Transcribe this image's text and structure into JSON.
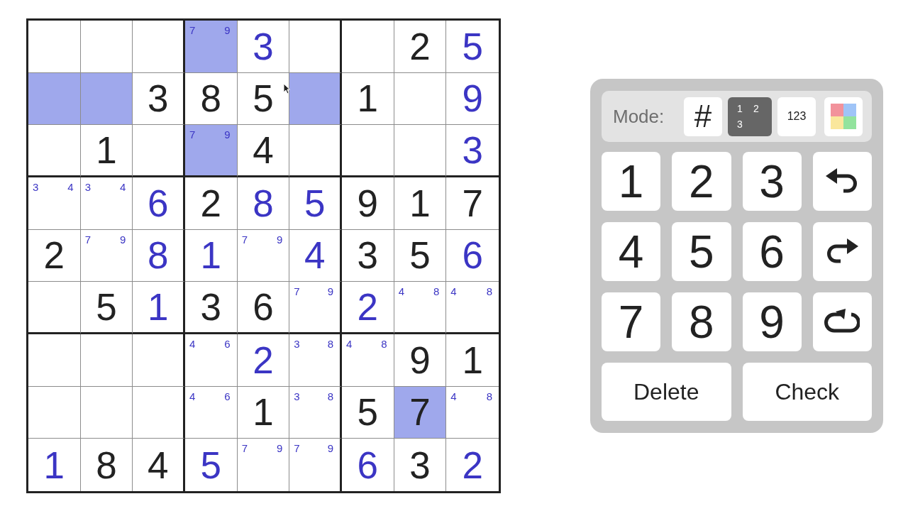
{
  "board": {
    "rows": [
      {
        "cells": [
          {
            "kind": "empty",
            "selected": false
          },
          {
            "kind": "empty",
            "selected": false
          },
          {
            "kind": "empty",
            "selected": false
          },
          {
            "kind": "notes",
            "notes": [
              "7",
              "9"
            ],
            "selected": true
          },
          {
            "kind": "entered",
            "value": "3",
            "selected": false
          },
          {
            "kind": "empty",
            "selected": false
          },
          {
            "kind": "empty",
            "selected": false
          },
          {
            "kind": "given",
            "value": "2",
            "selected": false
          },
          {
            "kind": "entered",
            "value": "5",
            "selected": false
          }
        ]
      },
      {
        "cells": [
          {
            "kind": "empty",
            "selected": true
          },
          {
            "kind": "empty",
            "selected": true
          },
          {
            "kind": "given",
            "value": "3",
            "selected": false
          },
          {
            "kind": "given",
            "value": "8",
            "selected": false
          },
          {
            "kind": "given",
            "value": "5",
            "selected": false
          },
          {
            "kind": "empty",
            "selected": true
          },
          {
            "kind": "given",
            "value": "1",
            "selected": false
          },
          {
            "kind": "empty",
            "selected": false
          },
          {
            "kind": "entered",
            "value": "9",
            "selected": false
          }
        ]
      },
      {
        "cells": [
          {
            "kind": "empty",
            "selected": false
          },
          {
            "kind": "given",
            "value": "1",
            "selected": false
          },
          {
            "kind": "empty",
            "selected": false
          },
          {
            "kind": "notes",
            "notes": [
              "7",
              "9"
            ],
            "selected": true
          },
          {
            "kind": "given",
            "value": "4",
            "selected": false
          },
          {
            "kind": "empty",
            "selected": false
          },
          {
            "kind": "empty",
            "selected": false
          },
          {
            "kind": "empty",
            "selected": false
          },
          {
            "kind": "entered",
            "value": "3",
            "selected": false
          }
        ]
      },
      {
        "cells": [
          {
            "kind": "notes",
            "notes": [
              "3",
              "4"
            ],
            "selected": false
          },
          {
            "kind": "notes",
            "notes": [
              "3",
              "4"
            ],
            "selected": false
          },
          {
            "kind": "entered",
            "value": "6",
            "selected": false
          },
          {
            "kind": "given",
            "value": "2",
            "selected": false
          },
          {
            "kind": "entered",
            "value": "8",
            "selected": false
          },
          {
            "kind": "entered",
            "value": "5",
            "selected": false
          },
          {
            "kind": "given",
            "value": "9",
            "selected": false
          },
          {
            "kind": "given",
            "value": "1",
            "selected": false
          },
          {
            "kind": "given",
            "value": "7",
            "selected": false
          }
        ]
      },
      {
        "cells": [
          {
            "kind": "given",
            "value": "2",
            "selected": false
          },
          {
            "kind": "notes",
            "notes": [
              "7",
              "9"
            ],
            "selected": false
          },
          {
            "kind": "entered",
            "value": "8",
            "selected": false
          },
          {
            "kind": "entered",
            "value": "1",
            "selected": false
          },
          {
            "kind": "notes",
            "notes": [
              "7",
              "9"
            ],
            "selected": false
          },
          {
            "kind": "entered",
            "value": "4",
            "selected": false
          },
          {
            "kind": "given",
            "value": "3",
            "selected": false
          },
          {
            "kind": "given",
            "value": "5",
            "selected": false
          },
          {
            "kind": "entered",
            "value": "6",
            "selected": false
          }
        ]
      },
      {
        "cells": [
          {
            "kind": "empty",
            "selected": false
          },
          {
            "kind": "given",
            "value": "5",
            "selected": false
          },
          {
            "kind": "entered",
            "value": "1",
            "selected": false
          },
          {
            "kind": "given",
            "value": "3",
            "selected": false
          },
          {
            "kind": "given",
            "value": "6",
            "selected": false
          },
          {
            "kind": "notes",
            "notes": [
              "7",
              "9"
            ],
            "selected": false
          },
          {
            "kind": "entered",
            "value": "2",
            "selected": false
          },
          {
            "kind": "notes",
            "notes": [
              "4",
              "8"
            ],
            "selected": false
          },
          {
            "kind": "notes",
            "notes": [
              "4",
              "8"
            ],
            "selected": false
          }
        ]
      },
      {
        "cells": [
          {
            "kind": "empty",
            "selected": false
          },
          {
            "kind": "empty",
            "selected": false
          },
          {
            "kind": "empty",
            "selected": false
          },
          {
            "kind": "notes",
            "notes": [
              "4",
              "6"
            ],
            "selected": false
          },
          {
            "kind": "entered",
            "value": "2",
            "selected": false
          },
          {
            "kind": "notes",
            "notes": [
              "3",
              "8"
            ],
            "selected": false
          },
          {
            "kind": "notes",
            "notes": [
              "4",
              "8"
            ],
            "selected": false
          },
          {
            "kind": "given",
            "value": "9",
            "selected": false
          },
          {
            "kind": "given",
            "value": "1",
            "selected": false
          }
        ]
      },
      {
        "cells": [
          {
            "kind": "empty",
            "selected": false
          },
          {
            "kind": "empty",
            "selected": false
          },
          {
            "kind": "empty",
            "selected": false
          },
          {
            "kind": "notes",
            "notes": [
              "4",
              "6"
            ],
            "selected": false
          },
          {
            "kind": "given",
            "value": "1",
            "selected": false
          },
          {
            "kind": "notes",
            "notes": [
              "3",
              "8"
            ],
            "selected": false
          },
          {
            "kind": "given",
            "value": "5",
            "selected": false
          },
          {
            "kind": "given",
            "value": "7",
            "selected": true
          },
          {
            "kind": "notes",
            "notes": [
              "4",
              "8"
            ],
            "selected": false
          }
        ]
      },
      {
        "cells": [
          {
            "kind": "entered",
            "value": "1",
            "selected": false
          },
          {
            "kind": "given",
            "value": "8",
            "selected": false
          },
          {
            "kind": "given",
            "value": "4",
            "selected": false
          },
          {
            "kind": "entered",
            "value": "5",
            "selected": false
          },
          {
            "kind": "notes",
            "notes": [
              "7",
              "9"
            ],
            "selected": false
          },
          {
            "kind": "notes",
            "notes": [
              "7",
              "9"
            ],
            "selected": false
          },
          {
            "kind": "entered",
            "value": "6",
            "selected": false
          },
          {
            "kind": "given",
            "value": "3",
            "selected": false
          },
          {
            "kind": "entered",
            "value": "2",
            "selected": false
          }
        ]
      }
    ]
  },
  "controls": {
    "mode_label": "Mode:",
    "modes": [
      {
        "kind": "normal",
        "label": "#",
        "selected": false
      },
      {
        "kind": "corner",
        "marks": [
          "1",
          "2",
          "3"
        ],
        "selected": true
      },
      {
        "kind": "center",
        "label": "123",
        "selected": false
      },
      {
        "kind": "color",
        "selected": false
      }
    ],
    "keys": [
      {
        "kind": "digit",
        "label": "1"
      },
      {
        "kind": "digit",
        "label": "2"
      },
      {
        "kind": "digit",
        "label": "3"
      },
      {
        "kind": "undo"
      },
      {
        "kind": "digit",
        "label": "4"
      },
      {
        "kind": "digit",
        "label": "5"
      },
      {
        "kind": "digit",
        "label": "6"
      },
      {
        "kind": "redo"
      },
      {
        "kind": "digit",
        "label": "7"
      },
      {
        "kind": "digit",
        "label": "8"
      },
      {
        "kind": "digit",
        "label": "9"
      },
      {
        "kind": "restart"
      }
    ],
    "actions": [
      "Delete",
      "Check"
    ]
  }
}
